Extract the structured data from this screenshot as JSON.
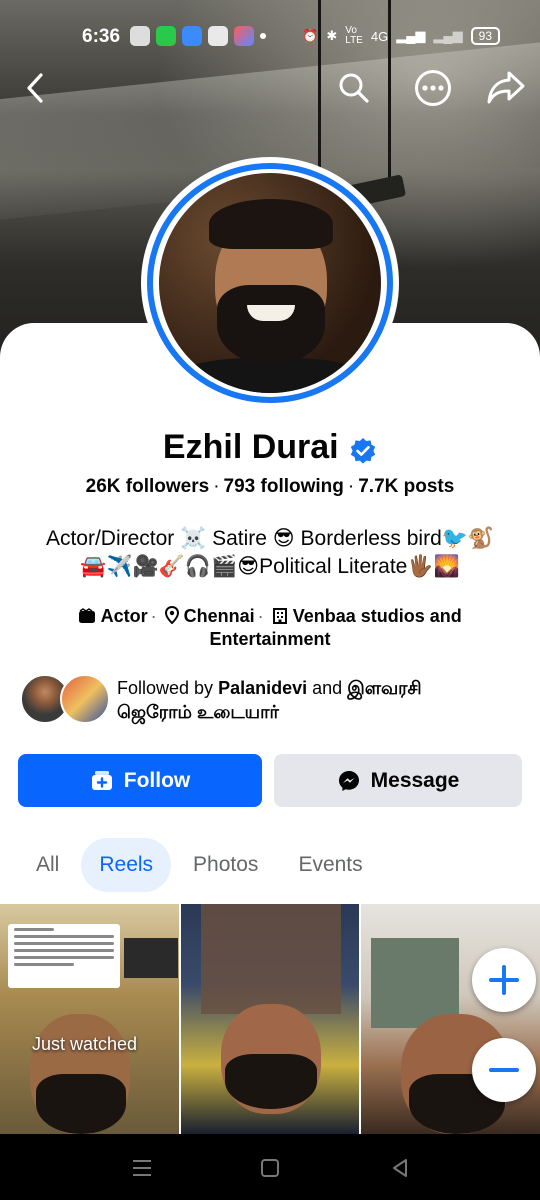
{
  "status_bar": {
    "time": "6:36",
    "network": "4G",
    "battery": "93"
  },
  "profile": {
    "name": "Ezhil Durai",
    "followers": "26K followers",
    "following": "793 following",
    "posts": "7.7K posts",
    "bio_line1": "Actor/Director ☠️ Satire 😎 Borderless bird🐦🐒",
    "bio_line2": "🚘✈️🎥🎸🎧🎬😎Political Literate🖐🏾🌄",
    "category": "Actor",
    "location": "Chennai",
    "work_line1": "Venbaa studios and",
    "work_line2": "Entertainment"
  },
  "mutual": {
    "prefix": "Followed by",
    "name1": "Palanidevi",
    "conj": "and",
    "name2_line1": "இளவரசி",
    "name2_line2": "ஜெரோம் உடையார்"
  },
  "actions": {
    "follow_label": "Follow",
    "message_label": "Message"
  },
  "tabs": [
    {
      "label": "All"
    },
    {
      "label": "Reels"
    },
    {
      "label": "Photos"
    },
    {
      "label": "Events"
    }
  ],
  "reels": {
    "first_caption": "Just watched"
  },
  "colors": {
    "accent": "#0866ff",
    "verified": "#1877f2",
    "secondary_button": "#e4e6eb"
  }
}
